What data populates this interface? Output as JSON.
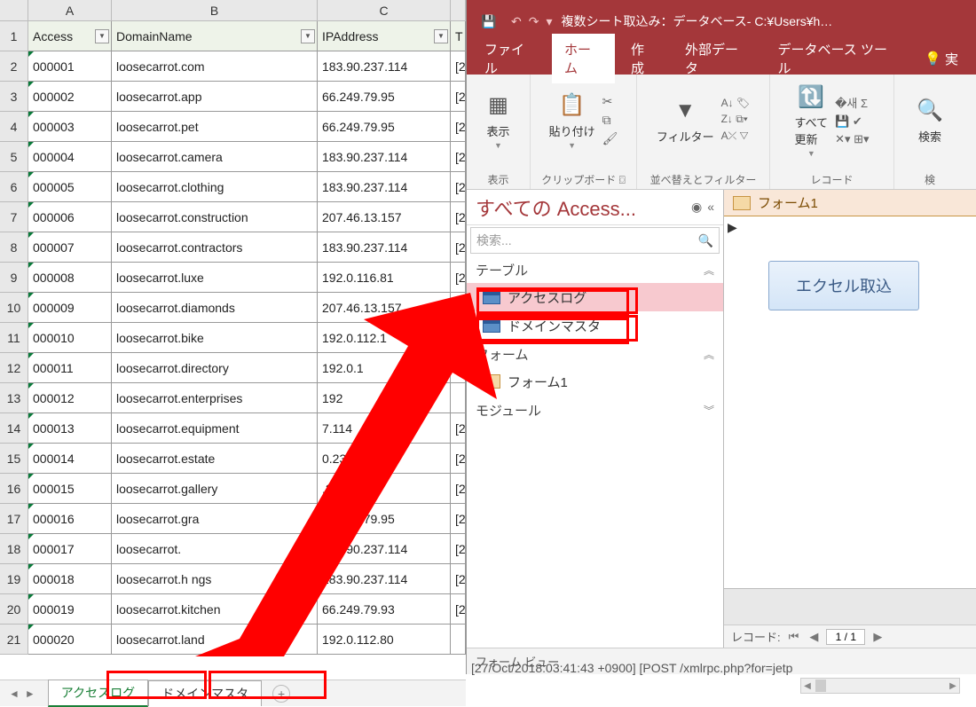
{
  "excel": {
    "columns": [
      "A",
      "B",
      "C"
    ],
    "header_row": {
      "a": "Access",
      "b": "DomainName",
      "c": "IPAddress",
      "d": "T"
    },
    "rows": [
      {
        "n": "2",
        "a": "000001",
        "b": "loosecarrot.com",
        "c": "183.90.237.114",
        "d": "[2"
      },
      {
        "n": "3",
        "a": "000002",
        "b": "loosecarrot.app",
        "c": "66.249.79.95",
        "d": "[2"
      },
      {
        "n": "4",
        "a": "000003",
        "b": "loosecarrot.pet",
        "c": "66.249.79.95",
        "d": "[2"
      },
      {
        "n": "5",
        "a": "000004",
        "b": "loosecarrot.camera",
        "c": "183.90.237.114",
        "d": "[2"
      },
      {
        "n": "6",
        "a": "000005",
        "b": "loosecarrot.clothing",
        "c": "183.90.237.114",
        "d": "[2"
      },
      {
        "n": "7",
        "a": "000006",
        "b": "loosecarrot.construction",
        "c": "207.46.13.157",
        "d": "[2"
      },
      {
        "n": "8",
        "a": "000007",
        "b": "loosecarrot.contractors",
        "c": "183.90.237.114",
        "d": "[2"
      },
      {
        "n": "9",
        "a": "000008",
        "b": "loosecarrot.luxe",
        "c": "192.0.116.81",
        "d": "[2"
      },
      {
        "n": "10",
        "a": "000009",
        "b": "loosecarrot.diamonds",
        "c": "207.46.13.157",
        "d": "[2"
      },
      {
        "n": "11",
        "a": "000010",
        "b": "loosecarrot.bike",
        "c": "192.0.112.1",
        "d": "[2"
      },
      {
        "n": "12",
        "a": "000011",
        "b": "loosecarrot.directory",
        "c": "192.0.1",
        "d": ""
      },
      {
        "n": "13",
        "a": "000012",
        "b": "loosecarrot.enterprises",
        "c": "192",
        "d": ""
      },
      {
        "n": "14",
        "a": "000013",
        "b": "loosecarrot.equipment",
        "c": "7.114",
        "d": "[2"
      },
      {
        "n": "15",
        "a": "000014",
        "b": "loosecarrot.estate",
        "c": "0.237.114",
        "d": "[2"
      },
      {
        "n": "16",
        "a": "000015",
        "b": "loosecarrot.gallery",
        "c": ".249.79.95",
        "d": "[2"
      },
      {
        "n": "17",
        "a": "000016",
        "b": "loosecarrot.gra",
        "c": "66.249.79.95",
        "d": "[2"
      },
      {
        "n": "18",
        "a": "000017",
        "b": "loosecarrot.",
        "c": "183.90.237.114",
        "d": "[2"
      },
      {
        "n": "19",
        "a": "000018",
        "b": "loosecarrot.h     ngs",
        "c": "183.90.237.114",
        "d": "[2"
      },
      {
        "n": "20",
        "a": "000019",
        "b": "loosecarrot.kitchen",
        "c": "66.249.79.93",
        "d": "[2"
      },
      {
        "n": "21",
        "a": "000020",
        "b": "loosecarrot.land",
        "c": "192.0.112.80",
        "d": ""
      }
    ],
    "sheet_tabs": {
      "active": "アクセスログ",
      "other": "ドメインマスタ"
    },
    "overflow_text": "[27/Oct/2018:03:41:43 +0900]   [POST /xmlrpc.php?for=jetp"
  },
  "access": {
    "title": "複数シート取込み：データベース- C:¥Users¥h…",
    "qat": {
      "save": "save-icon",
      "undo": "undo-icon",
      "redo": "redo-icon",
      "customize": "customize-icon"
    },
    "tabs": {
      "file": "ファイル",
      "home": "ホーム",
      "create": "作成",
      "external": "外部データ",
      "dbtools": "データベース ツール",
      "tell": "実"
    },
    "ribbon_groups": {
      "view": {
        "label": "表示",
        "btn": "表示"
      },
      "clipboard": {
        "label": "クリップボード",
        "btn": "貼り付け"
      },
      "sortfilter": {
        "label": "並べ替えとフィルター",
        "btn": "フィルター"
      },
      "records": {
        "label": "レコード",
        "btn": "すべて\n更新"
      },
      "find": {
        "label": "検",
        "btn": "検索"
      }
    },
    "nav": {
      "header": "すべての Access...",
      "search_placeholder": "検索...",
      "sections": {
        "tables": "テーブル",
        "forms": "フォーム",
        "modules": "モジュール"
      },
      "tables": [
        "アクセスログ",
        "ドメインマスタ"
      ],
      "forms": [
        "フォーム1"
      ]
    },
    "form": {
      "tab_label": "フォーム1",
      "button_label": "エクセル取込"
    },
    "record_nav": {
      "label": "レコード:",
      "value": "1 / 1"
    },
    "status": "フォーム ビュー"
  }
}
